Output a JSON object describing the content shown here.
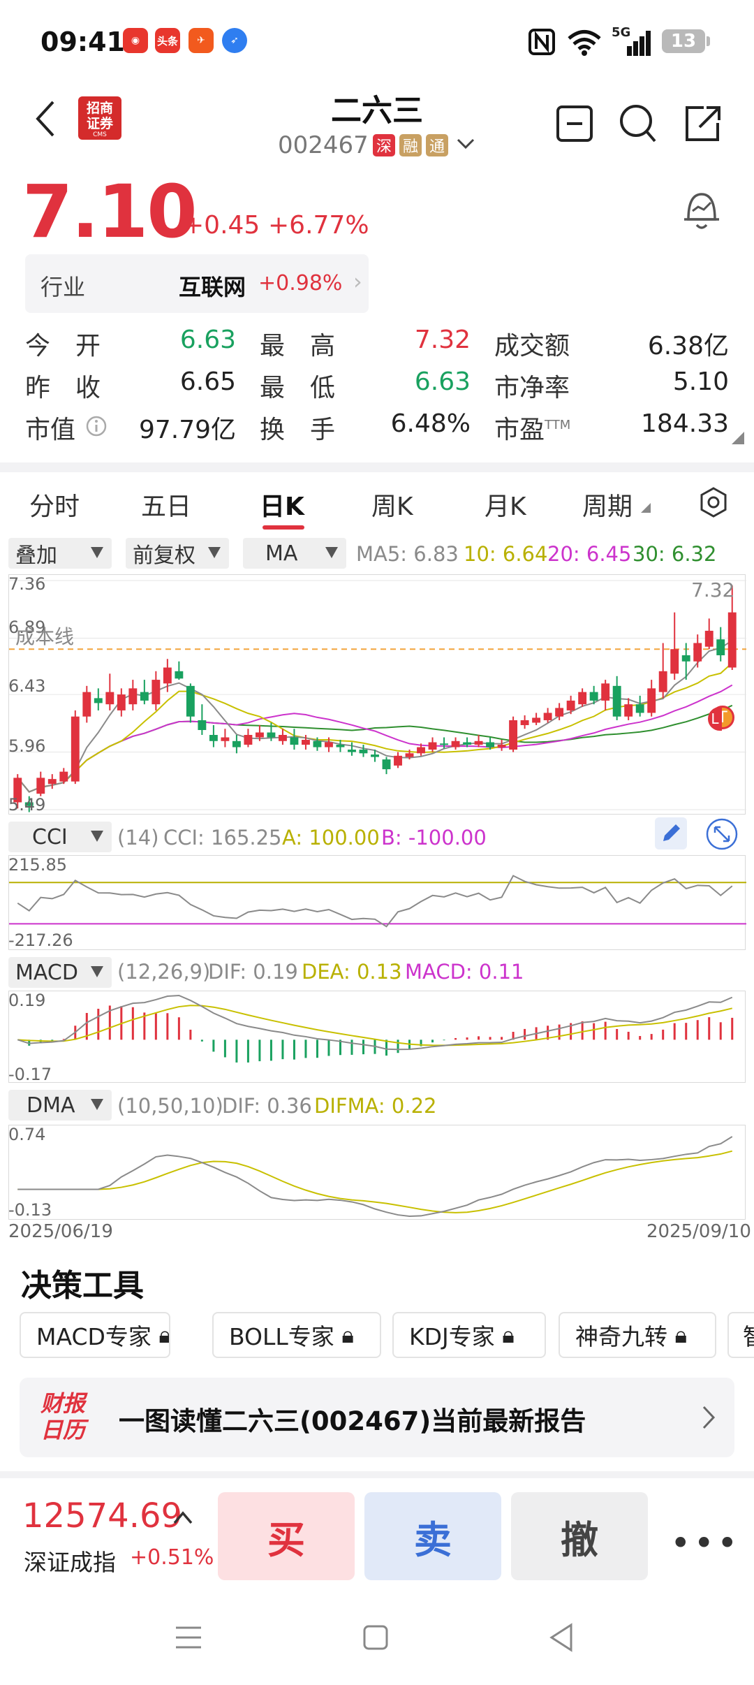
{
  "status_bar": {
    "time": "09:41",
    "apps": [
      {
        "icon": "netease-icon",
        "color": "#e8362d"
      },
      {
        "icon": "toutiao-icon",
        "label": "头条",
        "color": "#e8362d"
      },
      {
        "icon": "plane-app-icon",
        "color": "#f25a1e"
      },
      {
        "icon": "feather-app-icon",
        "color": "#2f7ef0"
      }
    ],
    "battery": "13",
    "signal_label": "5G"
  },
  "header": {
    "broker_logo_line1": "招商",
    "broker_logo_line2": "证券",
    "broker_logo_sub": "CMS",
    "stock_name": "二六三",
    "stock_code": "002467",
    "tags": [
      {
        "label": "深",
        "color": "#e0323e"
      },
      {
        "label": "融",
        "color": "#c8a062"
      },
      {
        "label": "通",
        "color": "#c8a062"
      }
    ]
  },
  "quote": {
    "price": "7.10",
    "change": "+0.45",
    "change_pct": "+6.77%",
    "industry_label": "行业",
    "industry_name": "互联网",
    "industry_pct": "+0.98%",
    "rows": [
      [
        {
          "label": "今　开",
          "value": "6.63",
          "color": "green"
        },
        {
          "label": "最　高",
          "value": "7.32",
          "color": "red"
        },
        {
          "label": "成交额",
          "value": "6.38亿",
          "color": "blk"
        }
      ],
      [
        {
          "label": "昨　收",
          "value": "6.65",
          "color": "blk"
        },
        {
          "label": "最　低",
          "value": "6.63",
          "color": "green"
        },
        {
          "label": "市净率",
          "value": "5.10",
          "color": "blk"
        }
      ],
      [
        {
          "label": "市值",
          "value": "97.79亿",
          "color": "blk"
        },
        {
          "label": "换　手",
          "value": "6.48%",
          "color": "blk"
        },
        {
          "label": "市盈",
          "sup": "TTM",
          "value": "184.33",
          "color": "blk"
        }
      ]
    ]
  },
  "tabs": [
    "分时",
    "五日",
    "日K",
    "周K",
    "月K",
    "周期"
  ],
  "active_tab": "日K",
  "kline": {
    "selectors": [
      "叠加",
      "前复权",
      "MA"
    ],
    "ma_text": {
      "ma5": "MA5: 6.83",
      "ma10": "10: 6.64",
      "ma20": "20: 6.45",
      "ma30": "30: 6.32"
    },
    "y_labels": [
      "7.36",
      "6.89",
      "6.43",
      "5.96",
      "5.49"
    ],
    "cost_line_label": "成本线",
    "high_label": "7.32",
    "low_mark": "L",
    "t_mark": "T"
  },
  "cci": {
    "selector": "CCI",
    "params": "(14)",
    "value": "CCI: 165.25",
    "a": "A: 100.00",
    "b": "B: -100.00",
    "y_top": "215.85",
    "y_bottom": "-217.26"
  },
  "macd": {
    "selector": "MACD",
    "params": "(12,26,9)",
    "dif": "DIF: 0.19",
    "dea": "DEA: 0.13",
    "macd": "MACD: 0.11",
    "y_top": "0.19",
    "y_bottom": "-0.17"
  },
  "dma": {
    "selector": "DMA",
    "params": "(10,50,10)",
    "dif": "DIF: 0.36",
    "difma": "DIFMA: 0.22",
    "y_top": "0.74",
    "y_bottom": "-0.13"
  },
  "date_range": {
    "start": "2025/06/19",
    "end": "2025/09/10"
  },
  "decision_tools": {
    "title": "决策工具",
    "chips": [
      "MACD专家",
      "BOLL专家",
      "KDJ专家",
      "神奇九转",
      "智"
    ],
    "banner_logo": "财报日历",
    "banner_text": "一图读懂二六三(002467)当前最新报告"
  },
  "bottom": {
    "index_value": "12574.69",
    "index_name": "深证成指",
    "index_pct": "+0.51%",
    "buy": "买",
    "sell": "卖",
    "cancel": "撤"
  },
  "candles": [
    [
      5.55,
      5.75,
      5.78,
      5.5
    ],
    [
      5.55,
      5.52,
      5.6,
      5.47
    ],
    [
      5.62,
      5.75,
      5.8,
      5.6
    ],
    [
      5.7,
      5.74,
      5.78,
      5.66
    ],
    [
      5.72,
      5.8,
      5.83,
      5.7
    ],
    [
      5.72,
      6.25,
      6.3,
      5.7
    ],
    [
      6.25,
      6.45,
      6.5,
      6.2
    ],
    [
      6.4,
      6.36,
      6.48,
      6.3
    ],
    [
      6.35,
      6.45,
      6.6,
      6.3
    ],
    [
      6.3,
      6.43,
      6.48,
      6.25
    ],
    [
      6.35,
      6.48,
      6.55,
      6.3
    ],
    [
      6.45,
      6.38,
      6.55,
      6.35
    ],
    [
      6.35,
      6.55,
      6.62,
      6.3
    ],
    [
      6.52,
      6.65,
      6.72,
      6.45
    ],
    [
      6.62,
      6.56,
      6.7,
      6.55
    ],
    [
      6.5,
      6.25,
      6.52,
      6.2
    ],
    [
      6.22,
      6.14,
      6.35,
      6.1
    ],
    [
      6.1,
      6.05,
      6.18,
      6.0
    ],
    [
      6.05,
      6.08,
      6.15,
      6.0
    ],
    [
      6.05,
      6.0,
      6.1,
      5.95
    ],
    [
      6.02,
      6.1,
      6.15,
      6.0
    ],
    [
      6.08,
      6.12,
      6.18,
      6.05
    ],
    [
      6.12,
      6.08,
      6.2,
      6.05
    ],
    [
      6.05,
      6.1,
      6.15,
      6.02
    ],
    [
      6.08,
      6.02,
      6.15,
      5.98
    ],
    [
      6.02,
      6.06,
      6.1,
      5.98
    ],
    [
      6.05,
      6.0,
      6.08,
      5.97
    ],
    [
      6.0,
      6.04,
      6.08,
      5.96
    ],
    [
      6.02,
      6.0,
      6.06,
      5.96
    ],
    [
      5.98,
      5.96,
      6.04,
      5.93
    ],
    [
      5.98,
      5.95,
      6.02,
      5.92
    ],
    [
      5.94,
      5.92,
      5.98,
      5.88
    ],
    [
      5.9,
      5.82,
      5.92,
      5.78
    ],
    [
      5.85,
      5.93,
      5.96,
      5.83
    ],
    [
      5.92,
      5.95,
      5.98,
      5.9
    ],
    [
      5.95,
      6.0,
      6.03,
      5.93
    ],
    [
      5.98,
      6.04,
      6.08,
      5.96
    ],
    [
      6.03,
      6.02,
      6.08,
      5.99
    ],
    [
      6.0,
      6.05,
      6.08,
      5.98
    ],
    [
      6.04,
      6.02,
      6.08,
      6.0
    ],
    [
      6.02,
      6.05,
      6.1,
      6.0
    ],
    [
      6.04,
      6.0,
      6.08,
      5.98
    ],
    [
      6.0,
      6.02,
      6.06,
      5.97
    ],
    [
      5.98,
      6.22,
      6.25,
      5.96
    ],
    [
      6.18,
      6.22,
      6.26,
      6.15
    ],
    [
      6.2,
      6.24,
      6.28,
      6.18
    ],
    [
      6.22,
      6.28,
      6.32,
      6.2
    ],
    [
      6.25,
      6.32,
      6.36,
      6.22
    ],
    [
      6.3,
      6.38,
      6.42,
      6.27
    ],
    [
      6.35,
      6.45,
      6.48,
      6.33
    ],
    [
      6.45,
      6.38,
      6.5,
      6.35
    ],
    [
      6.38,
      6.52,
      6.55,
      6.3
    ],
    [
      6.5,
      6.25,
      6.58,
      6.22
    ],
    [
      6.25,
      6.35,
      6.4,
      6.22
    ],
    [
      6.35,
      6.28,
      6.42,
      6.25
    ],
    [
      6.28,
      6.48,
      6.55,
      6.25
    ],
    [
      6.45,
      6.62,
      6.85,
      6.4
    ],
    [
      6.6,
      6.8,
      7.1,
      6.55
    ],
    [
      6.75,
      6.7,
      6.85,
      6.55
    ],
    [
      6.7,
      6.85,
      6.92,
      6.65
    ],
    [
      6.82,
      6.95,
      7.05,
      6.8
    ],
    [
      6.88,
      6.75,
      6.98,
      6.7
    ],
    [
      6.65,
      7.1,
      7.32,
      6.63
    ]
  ]
}
